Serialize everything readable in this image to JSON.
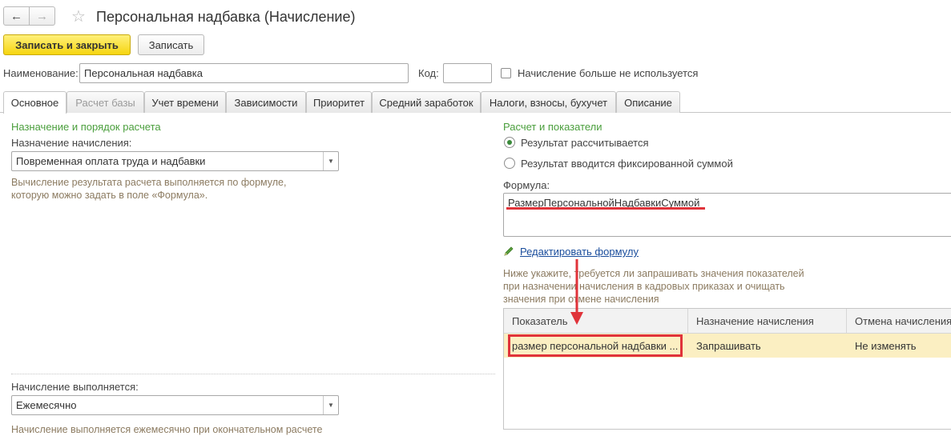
{
  "window": {
    "title": "Персональная надбавка (Начисление)",
    "back_icon": "←",
    "forward_icon": "→",
    "star_icon": "☆"
  },
  "toolbar": {
    "save_close_label": "Записать и закрыть",
    "save_label": "Записать"
  },
  "form": {
    "name_label": "Наименование:",
    "name_value": "Персональная надбавка",
    "code_label": "Код:",
    "code_value": "",
    "not_used_label": "Начисление больше не используется",
    "not_used_checked": false
  },
  "tabs": [
    {
      "label": "Основное",
      "active": true,
      "disabled": false
    },
    {
      "label": "Расчет базы",
      "active": false,
      "disabled": true
    },
    {
      "label": "Учет времени",
      "active": false,
      "disabled": false
    },
    {
      "label": "Зависимости",
      "active": false,
      "disabled": false
    },
    {
      "label": "Приоритет",
      "active": false,
      "disabled": false
    },
    {
      "label": "Средний заработок",
      "active": false,
      "disabled": false
    },
    {
      "label": "Налоги, взносы, бухучет",
      "active": false,
      "disabled": false
    },
    {
      "label": "Описание",
      "active": false,
      "disabled": false
    }
  ],
  "left": {
    "section_title": "Назначение и порядок расчета",
    "purpose_label": "Назначение начисления:",
    "purpose_value": "Повременная оплата труда и надбавки",
    "purpose_hint": "Вычисление результата расчета выполняется по формуле,\nкоторую можно задать в поле «Формула».",
    "performed_label": "Начисление выполняется:",
    "performed_value": "Ежемесячно",
    "performed_hint": "Начисление выполняется ежемесячно при окончательном расчете"
  },
  "right": {
    "section_title": "Расчет и показатели",
    "radio_calculated": "Результат рассчитывается",
    "radio_fixed": "Результат вводится фиксированной суммой",
    "selected_radio": "calculated",
    "formula_label": "Формула:",
    "formula_value": "РазмерПерсональнойНадбавкиСуммой",
    "edit_formula_link": "Редактировать формулу",
    "indicators_hint": "Ниже укажите, требуется ли запрашивать значения показателей\nпри назначении начисления в кадровых приказах и очищать\nзначения при отмене начисления"
  },
  "table": {
    "headers": [
      "Показатель",
      "Назначение начисления",
      "Отмена начисления"
    ],
    "rows": [
      [
        "размер персональной надбавки ...",
        "Запрашивать",
        "Не изменять"
      ]
    ]
  },
  "colors": {
    "accent_yellow": "#f6d510",
    "section_green": "#4a9e3c",
    "highlight_red": "#e0333a",
    "selected_row": "#fbefc2"
  }
}
